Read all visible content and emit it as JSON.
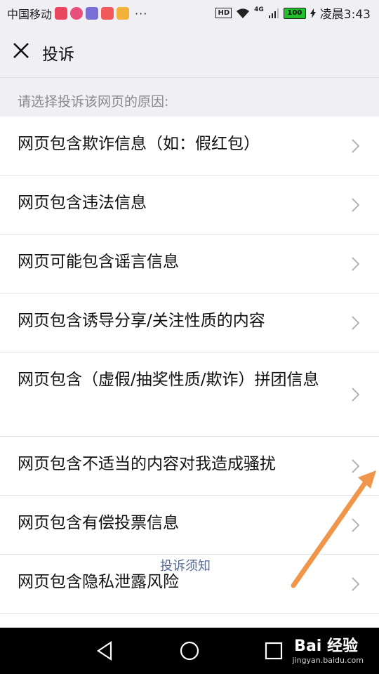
{
  "status_bar": {
    "carrier": "中国移动",
    "more": "···",
    "hd": "HD",
    "network": "4G",
    "battery": "100",
    "time": "凌晨3:43",
    "app_icons": [
      "#e8475f",
      "#e8475f",
      "#7a6fd6",
      "#f05a5a",
      "#f3b23a"
    ]
  },
  "header": {
    "title": "投诉"
  },
  "prompt": "请选择投诉该网页的原因:",
  "reasons": [
    "网页包含欺诈信息（如：假红包）",
    "网页包含违法信息",
    "网页可能包含谣言信息",
    "网页包含诱导分享/关注性质的内容",
    "网页包含（虚假/抽奖性质/欺诈）拼团信息",
    "网页包含不适当的内容对我造成骚扰",
    "网页包含有偿投票信息",
    "网页包含隐私泄露风险"
  ],
  "notice_link": "投诉须知",
  "watermark": {
    "brand": "Bai 经验",
    "url": "jingyan.baidu.com"
  },
  "colors": {
    "accent_link": "#576b95",
    "arrow": "#f0964a"
  }
}
